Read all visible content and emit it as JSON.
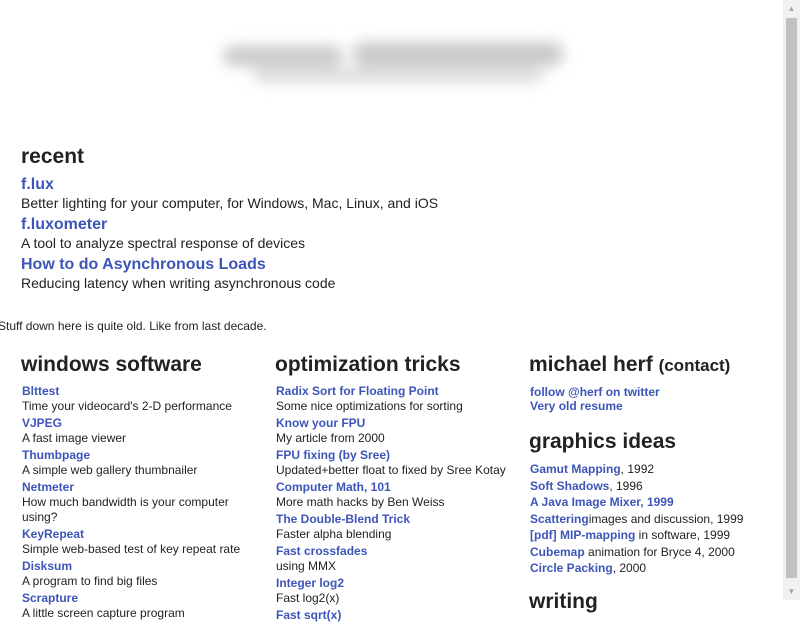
{
  "recent": {
    "title": "recent",
    "items": [
      {
        "link": "f.lux",
        "desc": "Better lighting for your computer, for Windows, Mac, Linux, and iOS"
      },
      {
        "link": "f.luxometer",
        "desc": "A tool to analyze spectral response of devices"
      },
      {
        "link": "How to do Asynchronous Loads",
        "desc": "Reducing latency when writing asynchronous code"
      }
    ]
  },
  "note": "Stuff down here is quite old. Like from last decade.",
  "windows": {
    "title": "windows software",
    "items": [
      {
        "link": "Blttest",
        "desc": "Time your videocard's 2-D performance"
      },
      {
        "link": "VJPEG",
        "desc": "A fast image viewer"
      },
      {
        "link": "Thumbpage",
        "desc": "A simple web gallery thumbnailer"
      },
      {
        "link": "Netmeter",
        "desc": "How much bandwidth is your computer using?"
      },
      {
        "link": "KeyRepeat",
        "desc": "Simple web-based test of key repeat rate"
      },
      {
        "link": "Disksum",
        "desc": "A program to find big files"
      },
      {
        "link": "Scrapture",
        "desc": "A little screen capture program"
      }
    ]
  },
  "optimization": {
    "title": "optimization tricks",
    "items": [
      {
        "link": "Radix Sort for Floating Point",
        "desc": "Some nice optimizations for sorting"
      },
      {
        "link": "Know your FPU",
        "desc": "My article from 2000"
      },
      {
        "link": "FPU fixing (by Sree)",
        "desc": "Updated+better float to fixed by Sree Kotay"
      },
      {
        "link": "Computer Math, 101",
        "desc": "More math hacks by Ben Weiss"
      },
      {
        "link": "The Double-Blend Trick",
        "desc": "Faster alpha blending"
      },
      {
        "link": "Fast crossfades",
        "desc": "using MMX"
      },
      {
        "link": "Integer log2",
        "desc": "Fast log2(x)"
      },
      {
        "link": "Fast sqrt(x)",
        "desc": ""
      }
    ]
  },
  "herf": {
    "title": "michael herf",
    "contact": "(contact)",
    "links": [
      "follow @herf on twitter",
      "Very old resume"
    ]
  },
  "graphics": {
    "title": "graphics ideas",
    "items": [
      {
        "link": "Gamut Mapping",
        "rest": ", 1992"
      },
      {
        "link": "Soft Shadows",
        "rest": ", 1996"
      },
      {
        "link": "A Java Image Mixer, 1999",
        "rest": ""
      },
      {
        "link": "Scattering",
        "rest": "images and discussion, 1999"
      },
      {
        "link": "[pdf] MIP-mapping",
        "rest": " in software, 1999"
      },
      {
        "link": "Cubemap",
        "rest": " animation for Bryce 4, 2000"
      },
      {
        "link": "Circle Packing",
        "rest": ", 2000"
      }
    ]
  },
  "writing": {
    "title": "writing"
  },
  "colors": {
    "link": "#3d55b8",
    "text": "#222222",
    "scrollbar": "#c1c1c1"
  }
}
